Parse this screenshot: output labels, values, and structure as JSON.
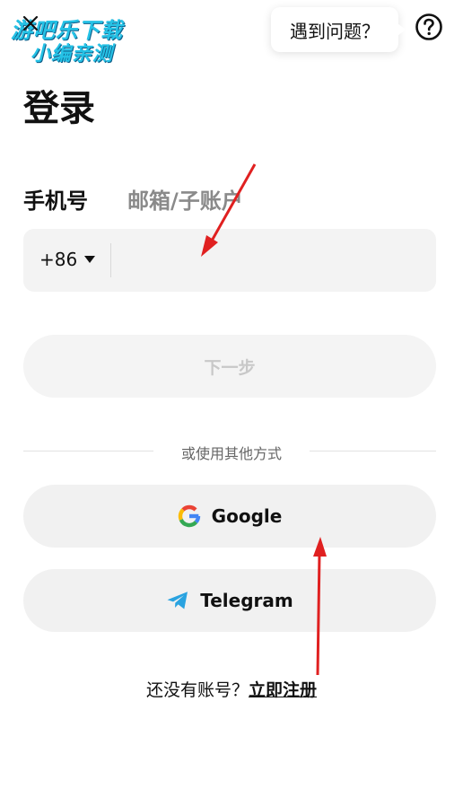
{
  "watermark": {
    "line1": "游吧乐下载",
    "line2": "小编亲测"
  },
  "header": {
    "help_label": "遇到问题？"
  },
  "page_title": "登录",
  "tabs": [
    {
      "label": "手机号",
      "active": true
    },
    {
      "label": "邮箱/子账户",
      "active": false
    }
  ],
  "phone": {
    "country_code": "+86",
    "value": ""
  },
  "next_label": "下一步",
  "divider_text": "或使用其他方式",
  "social": {
    "google_label": "Google",
    "telegram_label": "Telegram"
  },
  "signup": {
    "prompt": "还没有账号？",
    "link": "立即注册"
  },
  "colors": {
    "accent_arrow": "#e02020",
    "watermark": "#25c2e6",
    "telegram_blue": "#2aa3e0",
    "disabled_text": "#c8c8c8"
  },
  "icons": [
    "close-icon",
    "help-icon",
    "caret-down-icon",
    "google-icon",
    "telegram-icon"
  ]
}
